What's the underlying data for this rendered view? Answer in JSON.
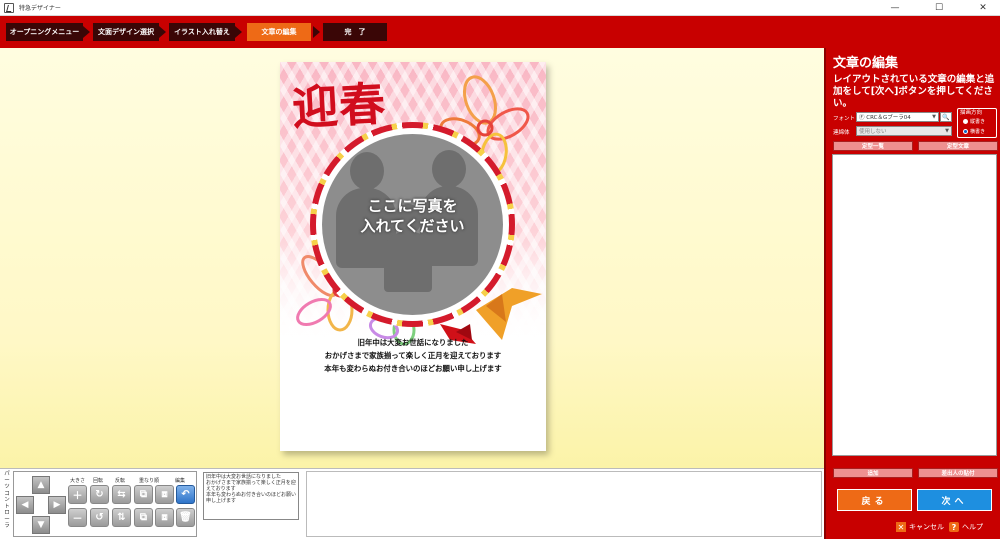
{
  "window": {
    "title": "特急デザイナー",
    "minimize": "—",
    "maximize": "☐",
    "close": "✕"
  },
  "steps": [
    {
      "label": "オープニングメニュー"
    },
    {
      "label": "文面デザイン選択"
    },
    {
      "label": "イラスト入れ替え"
    },
    {
      "label": "文章の編集"
    },
    {
      "label": "完　了"
    }
  ],
  "card": {
    "heading": "迎春",
    "photo_text_line1": "ここに写真を",
    "photo_text_line2": "入れてください",
    "greeting_line1": "旧年中は大変お世話になりました",
    "greeting_line2": "おかげさまで家族揃って楽しく正月を迎えております",
    "greeting_line3": "本年も変わらぬお付き合いのほどお願い申し上げます"
  },
  "right_panel": {
    "title": "文章の編集",
    "description": "レイアウトされている文章の編集と追加をして[次へ]ボタンを押してください。",
    "font_label": "フォント",
    "font_value": "Ⓕ CRC＆Gブーラ04",
    "search_icon": "🔍",
    "linked_label": "連綿体",
    "linked_value": "使用しない",
    "orientation_label": "描画方向",
    "vertical_label": "縦書き",
    "horizontal_label": "横書き",
    "fixed_list_button": "定型一覧",
    "fixed_text_button": "定型文章",
    "add_button": "追加",
    "sender_button": "差出人の貼付",
    "back_button": "戻る",
    "next_button": "次へ",
    "cancel_label": "キャンセル",
    "help_label": "ヘルプ"
  },
  "controller": {
    "side_label": "パーツコントローラ",
    "size_label": "大きさ",
    "rotate_label": "回転",
    "flip_label": "反転",
    "order_label": "重なり順",
    "edit_label": "編集",
    "text_preview": "旧年中は大変お世話になりました\nおかげさまで家族揃って楽しく正月を迎えております\n本年も変わらぬお付き合いのほどお願い申し上げます"
  },
  "colors": {
    "brand_red": "#c80000",
    "active_step": "#ee6a16",
    "back_button": "#ee6a16",
    "next_button": "#1e8fe0"
  }
}
